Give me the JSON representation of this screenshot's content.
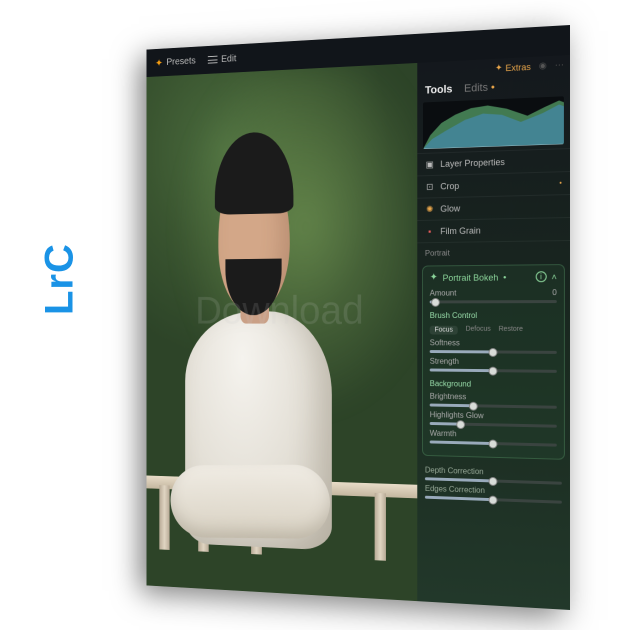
{
  "product_label": "LrC",
  "topbar": {
    "presets_label": "Presets",
    "edit_label": "Edit"
  },
  "extras": {
    "label": "Extras"
  },
  "panel": {
    "tab_tools": "Tools",
    "tab_edits": "Edits"
  },
  "sections": {
    "layer_properties": "Layer Properties",
    "crop": "Crop",
    "glow": "Glow",
    "film_grain": "Film Grain",
    "portrait_header": "Portrait"
  },
  "bokeh": {
    "title": "Portrait Bokeh",
    "amount": {
      "label": "Amount",
      "value": "0",
      "pct": 5
    },
    "brush_control": "Brush Control",
    "modes": {
      "focus": "Focus",
      "defocus": "Defocus",
      "restore": "Restore"
    },
    "softness": {
      "label": "Softness",
      "value": "",
      "pct": 50
    },
    "strength": {
      "label": "Strength",
      "value": "",
      "pct": 50
    },
    "background": "Background",
    "brightness": {
      "label": "Brightness",
      "value": "",
      "pct": 35
    },
    "highlights_glow": {
      "label": "Highlights Glow",
      "value": "",
      "pct": 25
    },
    "warmth": {
      "label": "Warmth",
      "value": "",
      "pct": 50
    },
    "depth_correction": {
      "label": "Depth Correction",
      "value": "",
      "pct": 50
    },
    "edge_correction": {
      "label": "Edges Correction",
      "value": "",
      "pct": 50
    }
  },
  "watermark": "Download"
}
